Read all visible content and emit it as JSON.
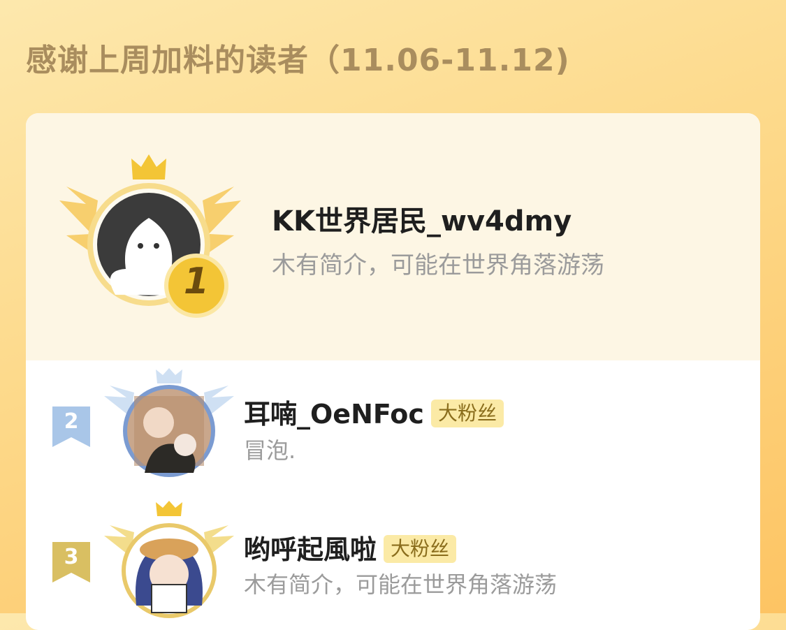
{
  "header": {
    "title": "感谢上周加料的读者（11.06-11.12)"
  },
  "readers": [
    {
      "rank": "1",
      "name": "KK世界居民_wv4dmy",
      "intro": "木有简介，可能在世界角落游荡",
      "badge": ""
    },
    {
      "rank": "2",
      "name": "耳喃_OeNFoc",
      "intro": "冒泡.",
      "badge": "大粉丝"
    },
    {
      "rank": "3",
      "name": "哟呼起風啦",
      "intro": "木有简介，可能在世界角落游荡",
      "badge": "大粉丝"
    }
  ],
  "colors": {
    "background": "#fdd98a",
    "title": "#a98d5e",
    "gold": "#f3c536",
    "silver": "#a9c6e8",
    "bronze": "#d9bf62",
    "badge_bg": "#fbeaa6"
  },
  "icons": [
    "crown-icon",
    "wings-icon",
    "rank-medal-icon",
    "rank-flag-icon",
    "default-avatar-icon"
  ]
}
